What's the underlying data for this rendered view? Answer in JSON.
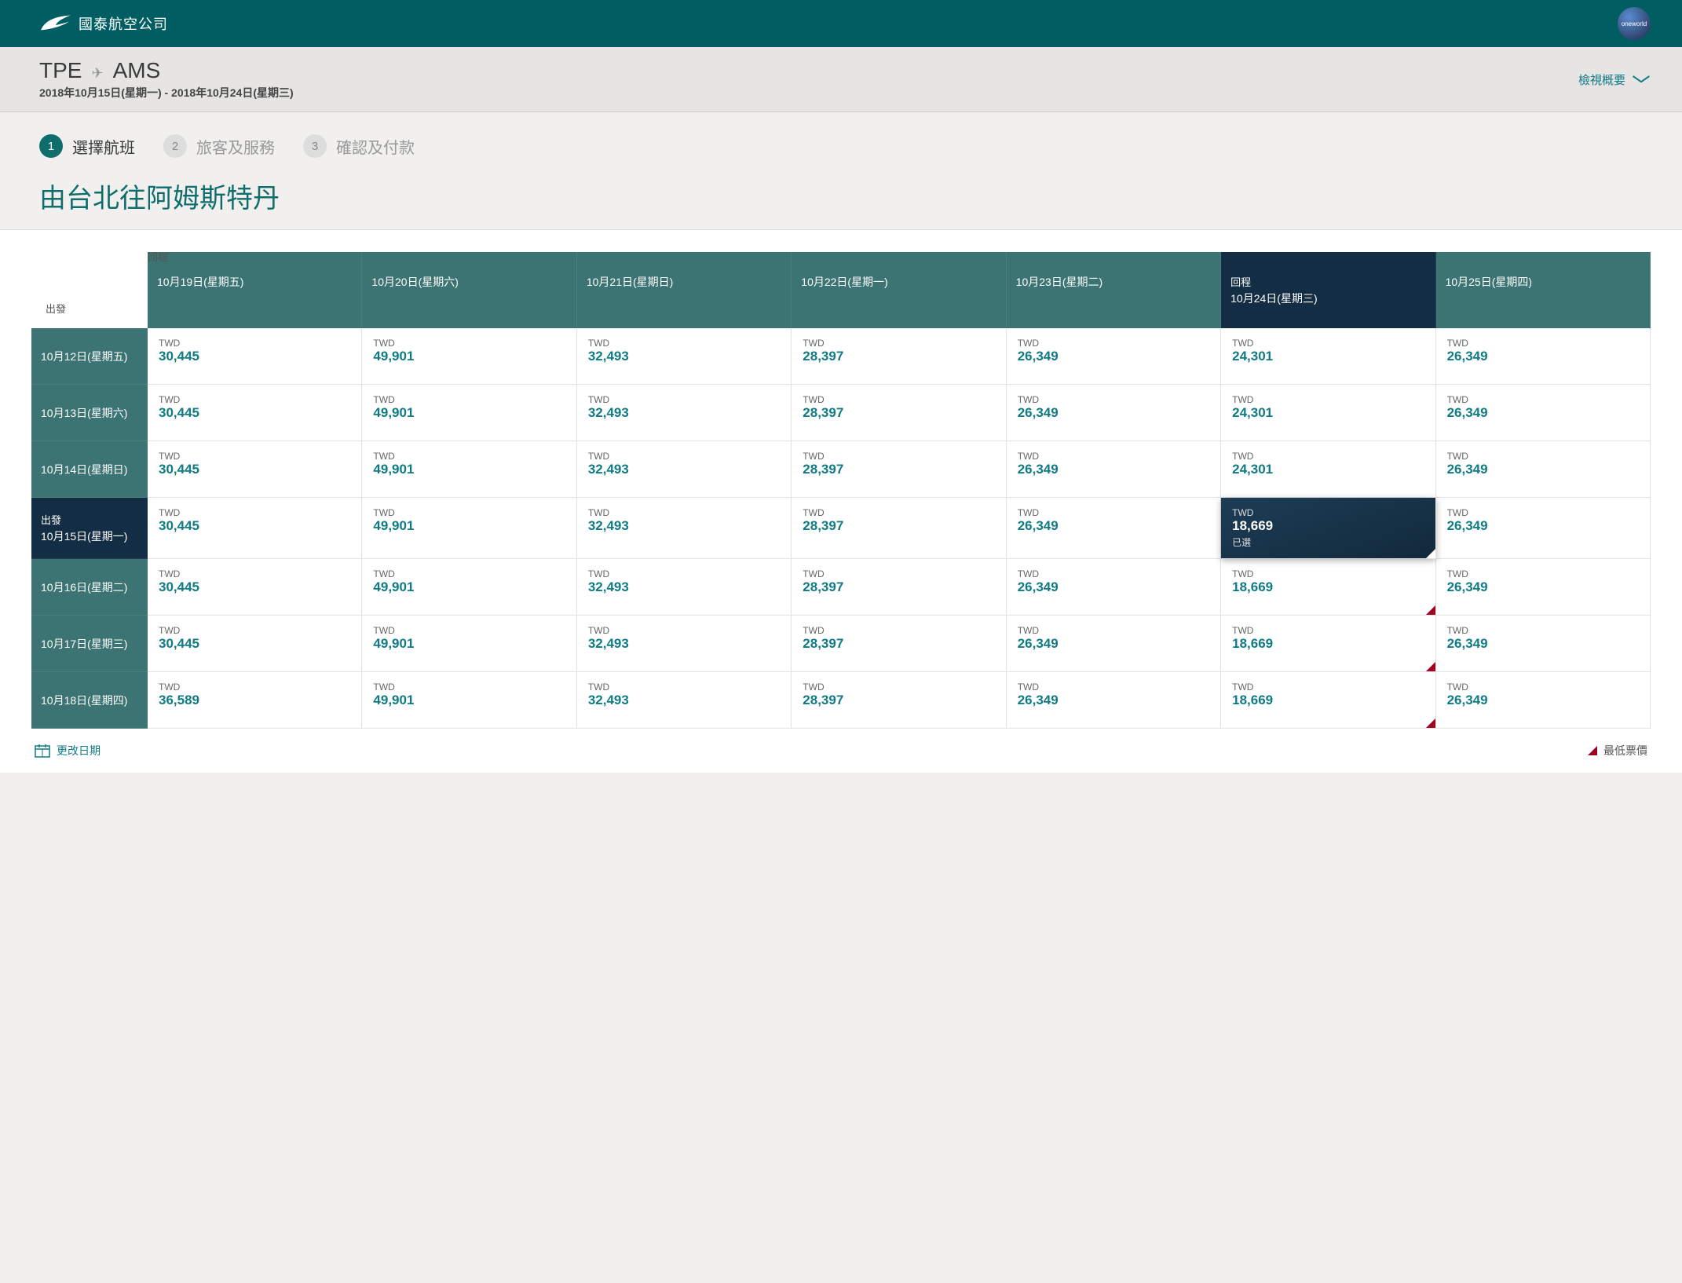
{
  "brand": {
    "name": "國泰航空公司",
    "badge": "oneworld"
  },
  "route": {
    "origin": "TPE",
    "dest": "AMS",
    "date_range": "2018年10月15日(星期一) - 2018年10月24日(星期三)"
  },
  "summary_toggle": "檢視概要",
  "steps": [
    {
      "num": "1",
      "label": "選擇航班",
      "active": true
    },
    {
      "num": "2",
      "label": "旅客及服務",
      "active": false
    },
    {
      "num": "3",
      "label": "確認及付款",
      "active": false
    }
  ],
  "page_title": "由台北往阿姆斯特丹",
  "axis": {
    "return": "回程",
    "depart": "出發"
  },
  "return_header_label": "回程",
  "depart_header_label": "出發",
  "currency": "TWD",
  "selected_label": "已選",
  "columns": [
    {
      "label": "10月19日(星期五)",
      "highlight": false
    },
    {
      "label": "10月20日(星期六)",
      "highlight": false
    },
    {
      "label": "10月21日(星期日)",
      "highlight": false
    },
    {
      "label": "10月22日(星期一)",
      "highlight": false
    },
    {
      "label": "10月23日(星期二)",
      "highlight": false
    },
    {
      "label": "10月24日(星期三)",
      "highlight": true
    },
    {
      "label": "10月25日(星期四)",
      "highlight": false
    }
  ],
  "rows": [
    {
      "label": "10月12日(星期五)",
      "highlight": false,
      "prices": [
        "30,445",
        "49,901",
        "32,493",
        "28,397",
        "26,349",
        "24,301",
        "26,349"
      ],
      "lowest": [],
      "selected": -1
    },
    {
      "label": "10月13日(星期六)",
      "highlight": false,
      "prices": [
        "30,445",
        "49,901",
        "32,493",
        "28,397",
        "26,349",
        "24,301",
        "26,349"
      ],
      "lowest": [],
      "selected": -1
    },
    {
      "label": "10月14日(星期日)",
      "highlight": false,
      "prices": [
        "30,445",
        "49,901",
        "32,493",
        "28,397",
        "26,349",
        "24,301",
        "26,349"
      ],
      "lowest": [],
      "selected": -1
    },
    {
      "label": "10月15日(星期一)",
      "highlight": true,
      "prices": [
        "30,445",
        "49,901",
        "32,493",
        "28,397",
        "26,349",
        "18,669",
        "26,349"
      ],
      "lowest": [],
      "selected": 5
    },
    {
      "label": "10月16日(星期二)",
      "highlight": false,
      "prices": [
        "30,445",
        "49,901",
        "32,493",
        "28,397",
        "26,349",
        "18,669",
        "26,349"
      ],
      "lowest": [
        5
      ],
      "selected": -1
    },
    {
      "label": "10月17日(星期三)",
      "highlight": false,
      "prices": [
        "30,445",
        "49,901",
        "32,493",
        "28,397",
        "26,349",
        "18,669",
        "26,349"
      ],
      "lowest": [
        5
      ],
      "selected": -1
    },
    {
      "label": "10月18日(星期四)",
      "highlight": false,
      "prices": [
        "36,589",
        "49,901",
        "32,493",
        "28,397",
        "26,349",
        "18,669",
        "26,349"
      ],
      "lowest": [
        5
      ],
      "selected": -1
    }
  ],
  "footer": {
    "change_date": "更改日期",
    "lowest_fare": "最低票價"
  }
}
